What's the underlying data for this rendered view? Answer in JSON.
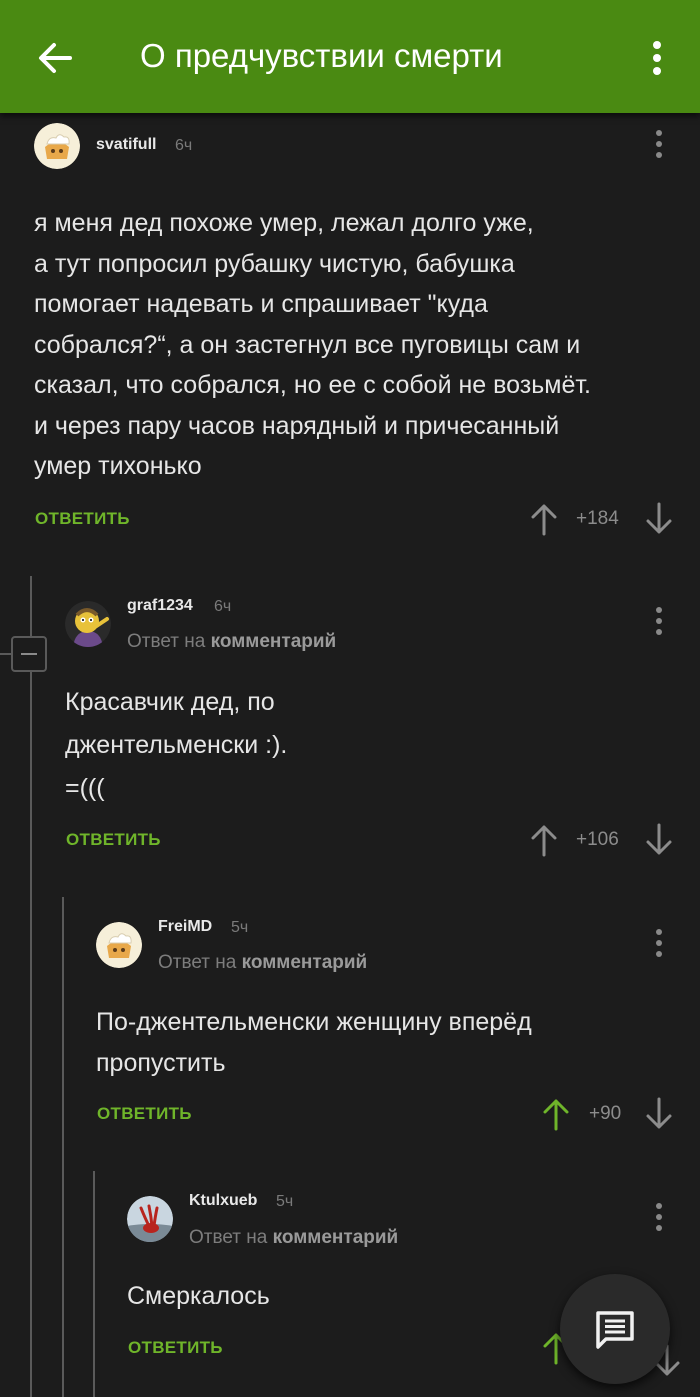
{
  "appbar": {
    "title": "О предчувствии смерти",
    "back_icon": "arrow-left-icon",
    "menu_icon": "more-vertical-icon",
    "background": "#4a8a12"
  },
  "reply_label": "Ответ на",
  "reply_target": "комментарий",
  "answer_label": "ОТВЕТИТЬ",
  "comments": [
    {
      "user": "svatifull",
      "time": "6ч",
      "text": "я меня дед похоже умер, лежал долго уже,\nа тут попросил рубашку чистую, бабушка\nпомогает надевать и спрашивает \"куда\nсобрался?“, а он застегнул все пуговицы сам и\nсказал, что собрался, но ее с собой не возьмёт.\nи через пару часов нарядный и причесанный\nумер тихонько",
      "score": "+184",
      "voted_up": false
    },
    {
      "user": "graf1234",
      "time": "6ч",
      "text": "Красавчик дед, по\n джентельменски :).\n=(((",
      "score": "+106",
      "voted_up": false
    },
    {
      "user": "FreiMD",
      "time": "5ч",
      "text": "По-джентельменски женщину вперёд\nпропустить",
      "score": "+90",
      "voted_up": true
    },
    {
      "user": "Ktulxueb",
      "time": "5ч",
      "text": "Смеркалось",
      "score": "",
      "voted_up": true
    }
  ],
  "colors": {
    "accent": "#6fb52a",
    "background": "#1c1c1c",
    "thread_line": "#5a5a5a"
  },
  "fab_icon": "comment-icon"
}
